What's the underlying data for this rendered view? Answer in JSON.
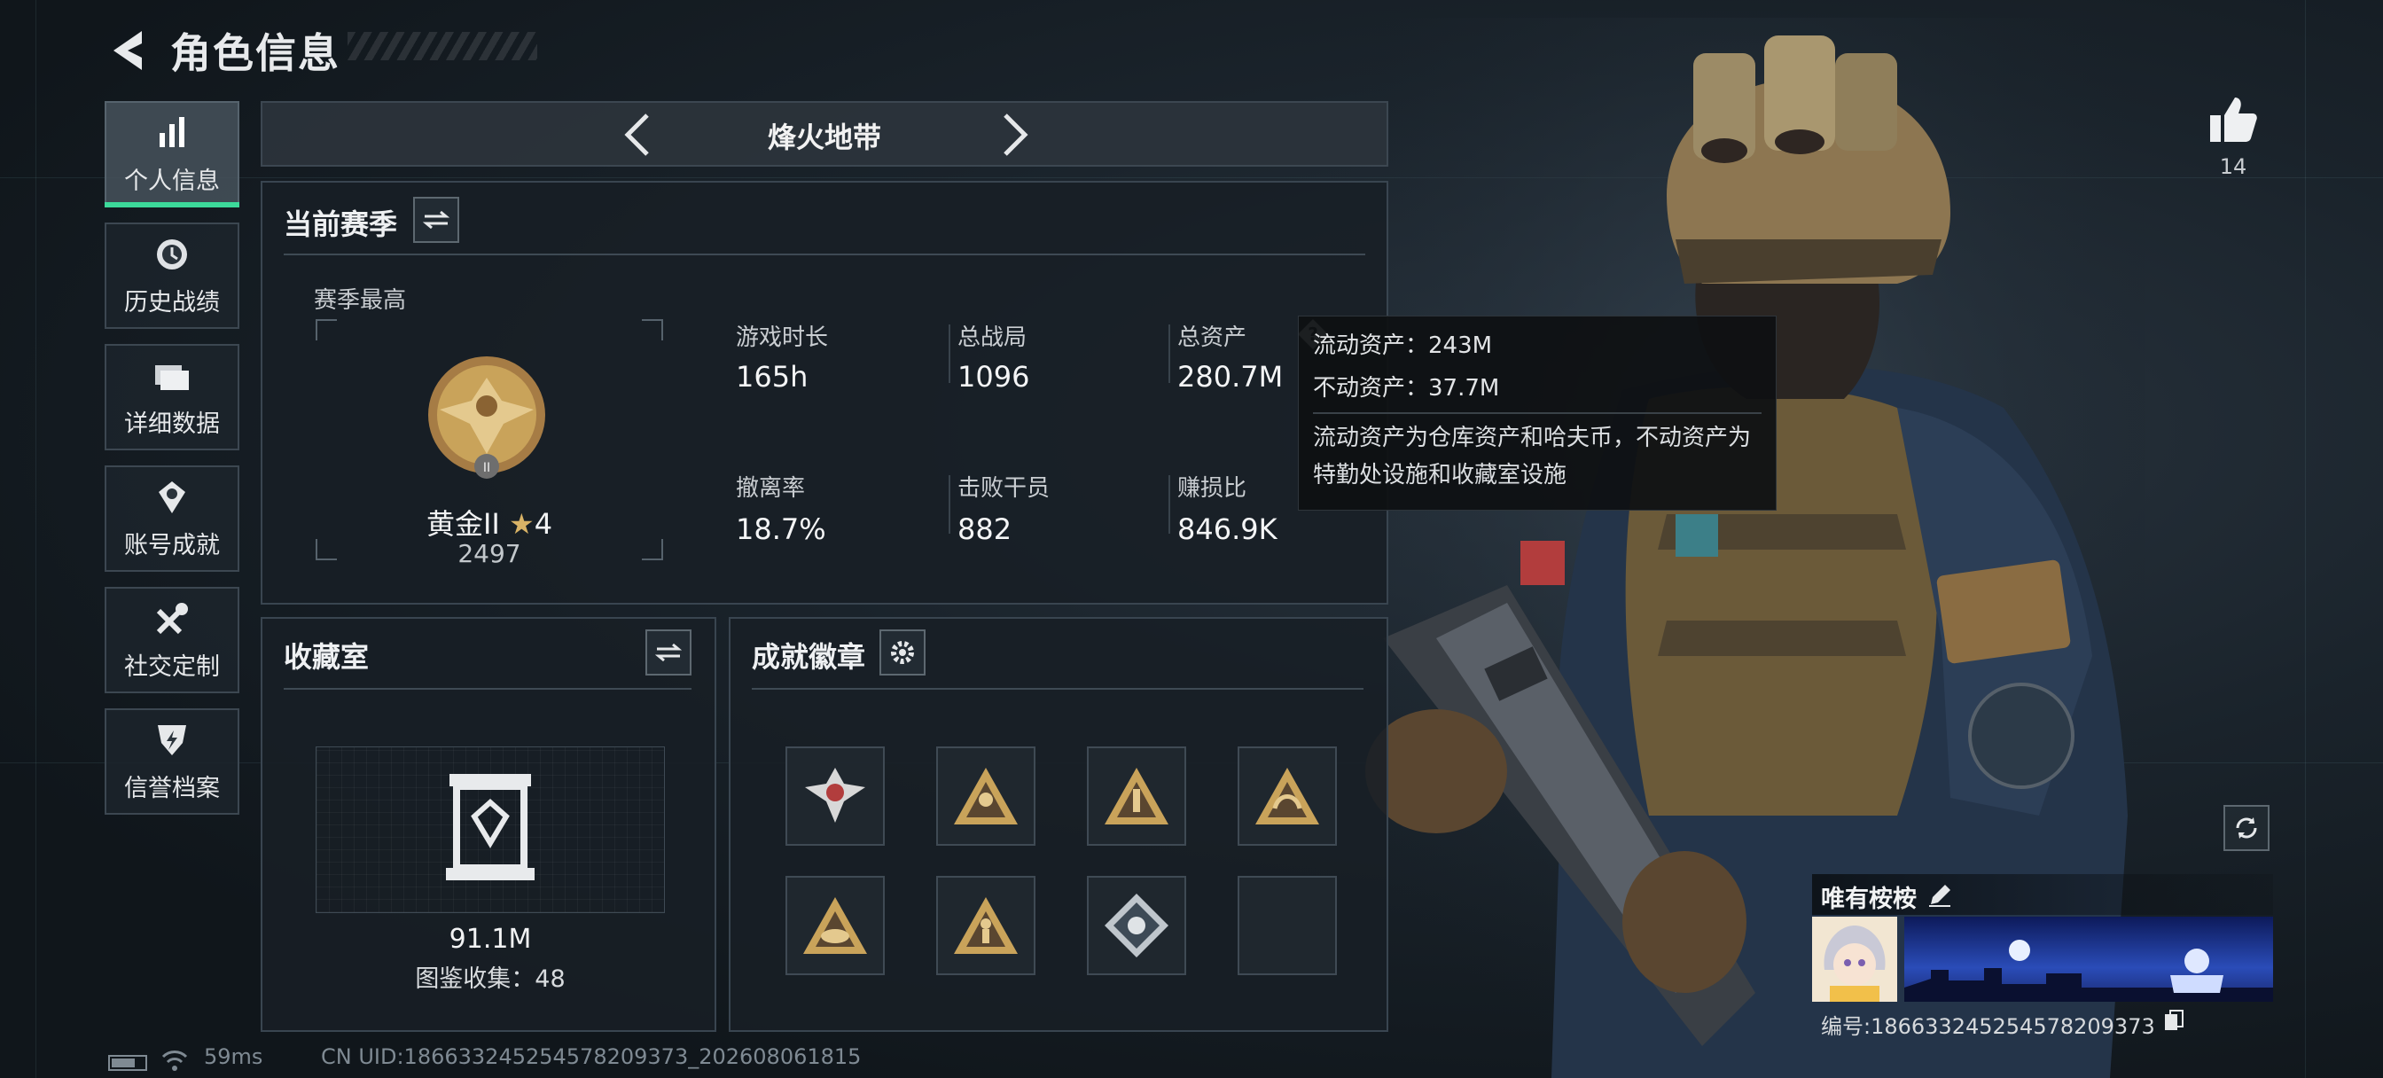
{
  "header": {
    "title": "角色信息"
  },
  "sidebar": {
    "items": [
      {
        "label": "个人信息",
        "icon": "bar-chart-icon",
        "active": true
      },
      {
        "label": "历史战绩",
        "icon": "history-icon"
      },
      {
        "label": "详细数据",
        "icon": "folder-icon"
      },
      {
        "label": "账号成就",
        "icon": "achievement-icon"
      },
      {
        "label": "社交定制",
        "icon": "tools-icon"
      },
      {
        "label": "信誉档案",
        "icon": "shield-icon"
      }
    ]
  },
  "mode": {
    "title": "烽火地带"
  },
  "season": {
    "title": "当前赛季",
    "best_label": "赛季最高",
    "rank_name": "黄金II",
    "rank_stars": "4",
    "rank_score": "2497",
    "rank_numeral": "II",
    "stats": [
      {
        "label": "游戏时长",
        "value": "165h"
      },
      {
        "label": "总战局",
        "value": "1096"
      },
      {
        "label": "总资产",
        "value": "280.7M"
      },
      {
        "label": "撤离率",
        "value": "18.7%"
      },
      {
        "label": "击败干员",
        "value": "882"
      },
      {
        "label": "赚损比",
        "value": "846.9K"
      }
    ]
  },
  "tooltip": {
    "liquid": "流动资产：243M",
    "fixed": "不动资产：37.7M",
    "desc": "流动资产为仓库资产和哈夫币，不动资产为特勤处设施和收藏室设施"
  },
  "collection": {
    "title": "收藏室",
    "value": "91.1M",
    "catalog": "图鉴收集：48"
  },
  "achievements": {
    "title": "成就徽章",
    "badges": [
      "eagle-badge",
      "soldier-triangle-badge",
      "rocket-triangle-badge",
      "dragon-triangle-badge",
      "hat-triangle-badge",
      "figure-triangle-badge",
      "diamond-badge",
      "empty-slot"
    ]
  },
  "likes": {
    "count": "14"
  },
  "player": {
    "name": "唯有桉桉",
    "id": "编号:186633245254578209373"
  },
  "status": {
    "ping": "59ms",
    "uid": "CN UID:186633245254578209373_202608061815"
  },
  "colors": {
    "accent": "#3cd99a",
    "gold": "#c9a35a",
    "panel_border": "#394550"
  }
}
